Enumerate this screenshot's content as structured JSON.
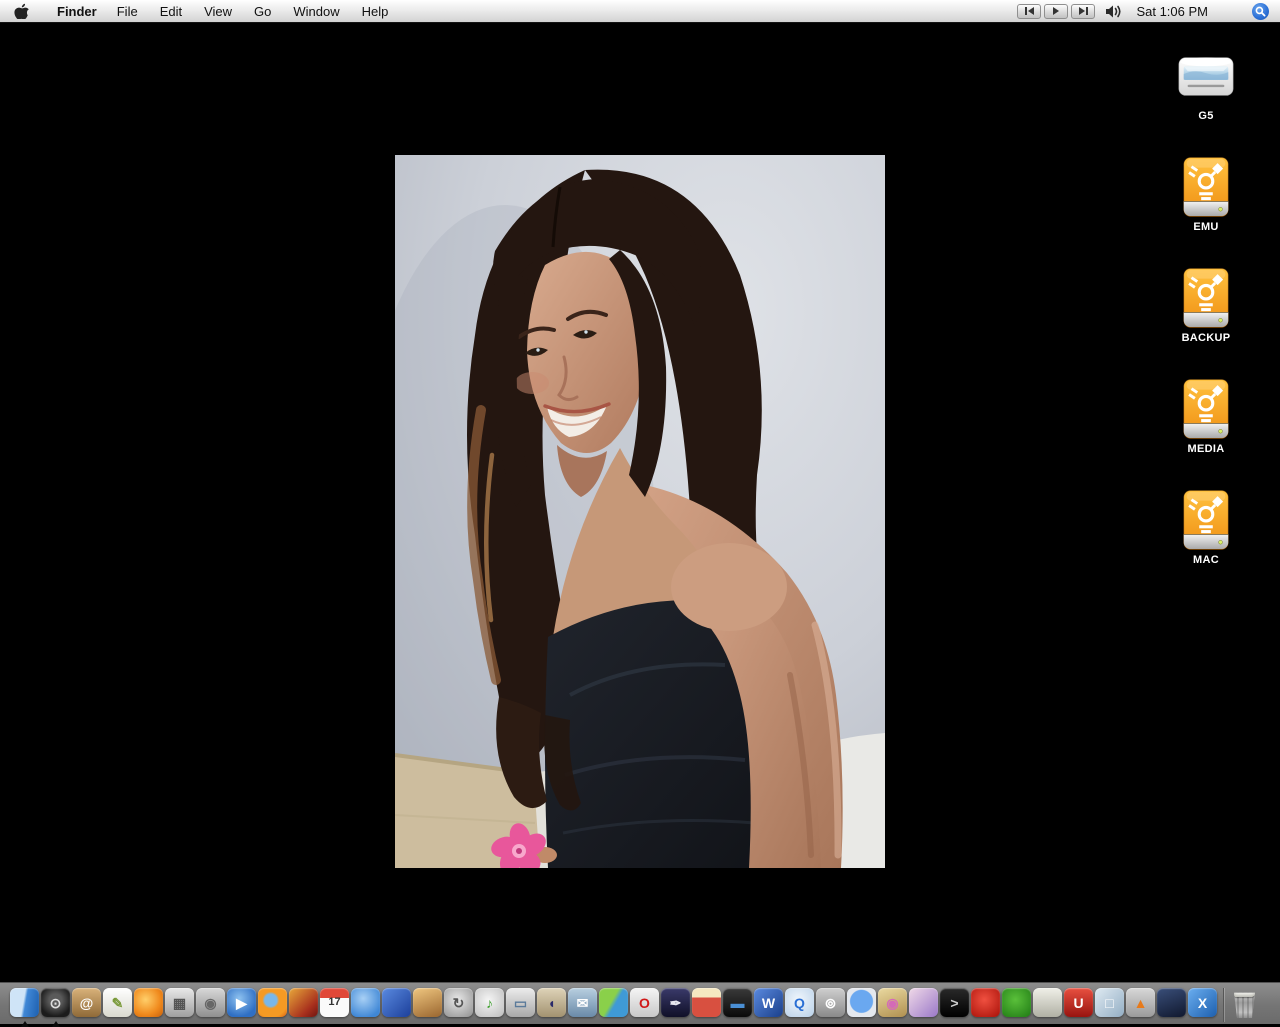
{
  "menubar": {
    "app_name": "Finder",
    "menus": [
      "File",
      "Edit",
      "View",
      "Go",
      "Window",
      "Help"
    ],
    "media_controls": [
      {
        "id": "previous"
      },
      {
        "id": "play"
      },
      {
        "id": "next"
      }
    ],
    "clock": "Sat 1:06 PM"
  },
  "desktop": {
    "wallpaper_color": "#000000",
    "photo": {
      "description": "Portrait photo of a smiling young woman with long dark brown hair, wearing a black strapless top, holding a pink flower, in front of a light gray wall with a bed and headboard"
    },
    "drives": [
      {
        "label": "G5",
        "kind": "computer"
      },
      {
        "label": "EMU",
        "kind": "firewire-drive"
      },
      {
        "label": "BACKUP",
        "kind": "firewire-drive"
      },
      {
        "label": "MEDIA",
        "kind": "firewire-drive"
      },
      {
        "label": "MAC",
        "kind": "firewire-drive"
      }
    ],
    "drive_orange": "#f59f1d"
  },
  "dock": {
    "background": "#7d7d7d",
    "items": [
      {
        "id": "finder",
        "bg": "linear-gradient(100deg,#cfe4f7 0 46%,#3f87d6 54%,#1d5fae)",
        "running": true
      },
      {
        "id": "dashboard",
        "bg": "radial-gradient(circle at 50% 42%,#5a5a5a 0 28%,#1c1c1c 72%)",
        "glyph": "⊙",
        "fg": "#dddddd",
        "running": true
      },
      {
        "id": "address-book",
        "bg": "linear-gradient(180deg,#d9b27a,#8f6a38)",
        "glyph": "@",
        "fg": "#ffffff"
      },
      {
        "id": "textedit",
        "bg": "linear-gradient(180deg,#ffffff,#d9d9cf)",
        "glyph": "✎",
        "fg": "#7a9a3a"
      },
      {
        "id": "fetch",
        "bg": "radial-gradient(circle at 40% 40%,#ffcf6a,#f08a1d 60%,#c85f0a)"
      },
      {
        "id": "calculator",
        "bg": "linear-gradient(180deg,#e8e8e8,#9f9f9f)",
        "glyph": "▦",
        "fg": "#555555"
      },
      {
        "id": "dvd-player",
        "bg": "linear-gradient(180deg,#d8d8d8,#8f8f8f)",
        "glyph": "◉",
        "fg": "#666666"
      },
      {
        "id": "windows-media-player",
        "bg": "radial-gradient(circle at 42% 36%,#8ec2f0,#2f6fc4 72%)",
        "glyph": "▶",
        "fg": "#ffffff"
      },
      {
        "id": "firefox",
        "bg": "radial-gradient(circle at 44% 42%,#7ab7e8 0 26%,#f59a23 36% 72%,#d95f12)"
      },
      {
        "id": "cocktail",
        "bg": "linear-gradient(135deg,#e8a83a,#a8301d 70%,#6f1410)"
      },
      {
        "id": "ical",
        "bg": "linear-gradient(180deg,#e04838 0 34%,#fafafa 34%)",
        "glyph": "17",
        "fg": "#333333"
      },
      {
        "id": "ichat",
        "bg": "radial-gradient(circle at 42% 36%,#a8d0f5,#3f87d6 78%)"
      },
      {
        "id": "imovie",
        "bg": "linear-gradient(135deg,#5a8ae0,#1c3f9a)"
      },
      {
        "id": "iphoto",
        "bg": "linear-gradient(160deg,#f0c780,#9a662f)"
      },
      {
        "id": "isync",
        "bg": "radial-gradient(circle at 46% 40%,#e8e8e8,#8f8f8f)",
        "glyph": "↻",
        "fg": "#555555"
      },
      {
        "id": "itunes",
        "bg": "radial-gradient(circle at 46% 42%,#f5f5f5,#bcbcbc)",
        "glyph": "♪",
        "fg": "#3fa12f"
      },
      {
        "id": "grab-device",
        "bg": "linear-gradient(180deg,#ececec,#a8a8a8)",
        "glyph": "▭",
        "fg": "#5a7a9a"
      },
      {
        "id": "macmame",
        "bg": "linear-gradient(180deg,#ded3b8,#a39270)",
        "glyph": "◖",
        "fg": "#2a2a6a"
      },
      {
        "id": "mail",
        "bg": "linear-gradient(180deg,#b8cfe0,#6a8aa8)",
        "glyph": "✉",
        "fg": "#ffffff"
      },
      {
        "id": "msn-messenger",
        "bg": "linear-gradient(120deg,#8ad04a 0 44%,#3f9ad6 56%)"
      },
      {
        "id": "opera",
        "bg": "linear-gradient(180deg,#f5f5f5,#c8c8c8)",
        "glyph": "O",
        "fg": "#d01818"
      },
      {
        "id": "ink-pen",
        "bg": "linear-gradient(180deg,#3a3a6a,#101028)",
        "glyph": "✒",
        "fg": "#e8e8f0"
      },
      {
        "id": "popcorn",
        "bg": "linear-gradient(180deg,#f5e8c0 0 32%,#d85040 32%)"
      },
      {
        "id": "psp",
        "bg": "linear-gradient(180deg,#3a3a3a,#0a0a0a)",
        "glyph": "▬",
        "fg": "#4a8fd4"
      },
      {
        "id": "word",
        "bg": "linear-gradient(135deg,#5a8ae0,#1a3f8a)",
        "glyph": "W",
        "fg": "#ffffff"
      },
      {
        "id": "quicktime",
        "bg": "radial-gradient(circle at 46% 40%,#f0f6fc,#b8d0e8)",
        "glyph": "Q",
        "fg": "#2a6fd4"
      },
      {
        "id": "satellite-dish",
        "bg": "linear-gradient(180deg,#cfcfcf,#8a8a8a)",
        "glyph": "⊚",
        "fg": "#ffffff"
      },
      {
        "id": "safari",
        "bg": "radial-gradient(circle at 50% 46%,#6aa8f0 0 52%,#e4e8ee 56%)"
      },
      {
        "id": "map-app",
        "bg": "linear-gradient(160deg,#ead9a0,#b09050)",
        "glyph": "◉",
        "fg": "#d46ab8"
      },
      {
        "id": "comic-life",
        "bg": "linear-gradient(135deg,#f0d9e8,#9a78c8)"
      },
      {
        "id": "terminal",
        "bg": "linear-gradient(180deg,#2a2a2a,#000000)",
        "glyph": ">",
        "fg": "#cfcfcf"
      },
      {
        "id": "red-creature",
        "bg": "radial-gradient(circle at 46% 40%,#f05040,#a81008)"
      },
      {
        "id": "green-creature",
        "bg": "radial-gradient(circle at 46% 40%,#5ac03a,#1f7a14)"
      },
      {
        "id": "toast",
        "bg": "linear-gradient(180deg,#f0f0e8,#b0b0a4)"
      },
      {
        "id": "magnet",
        "bg": "linear-gradient(180deg,#e85040,#981410)",
        "glyph": "U",
        "fg": "#ffffff"
      },
      {
        "id": "cube-stack",
        "bg": "linear-gradient(135deg,#dfeaf2,#93aec4)",
        "glyph": "□",
        "fg": "#ffffff"
      },
      {
        "id": "vlc",
        "bg": "linear-gradient(180deg,#d8d8d8,#9a9a9a)",
        "glyph": "▲",
        "fg": "#e87a1a"
      },
      {
        "id": "camera-bag",
        "bg": "linear-gradient(160deg,#3a4f7a,#10182e)"
      },
      {
        "id": "x11",
        "bg": "linear-gradient(135deg,#6aaef0,#1d5fae)",
        "glyph": "X",
        "fg": "#ffffff"
      }
    ],
    "trash": {
      "id": "trash",
      "state": "full"
    }
  }
}
